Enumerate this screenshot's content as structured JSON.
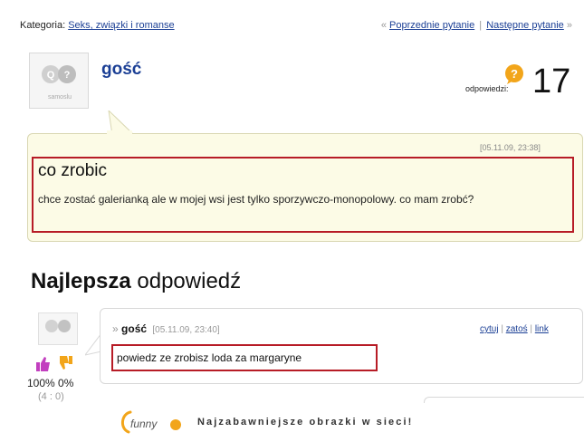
{
  "topbar": {
    "category_label": "Kategoria:",
    "category_link": "Seks, związki i romanse",
    "prev_arrow": "«",
    "prev_link": "Poprzednie pytanie",
    "separator": "|",
    "next_link": "Następne pytanie",
    "next_arrow": "»"
  },
  "question": {
    "avatar_caption": "samoslu",
    "author": "gość",
    "answers_label": "odpowiedzi:",
    "answers_count": "17",
    "date": "[05.11.09, 23:38]",
    "title": "co zrobic",
    "body": "chce zostać galerianką ale w mojej wsi jest tylko sporzywczo-monopolowy. co mam zrobć?"
  },
  "best_answer": {
    "heading_bold": "Najlepsza",
    "heading_rest": " odpowiedź",
    "bullet": "»",
    "author": "gość",
    "date": "[05.11.09, 23:40]",
    "links": {
      "cite": "cytuj",
      "report": "zatoś",
      "link": "link",
      "sep": "|"
    },
    "text": "powiedz ze zrobisz loda za margaryne",
    "votes": "100%  0%",
    "vote_count": "(4 : 0)"
  },
  "footer": {
    "logo_text": "funny",
    "tagline": "Najzabawniejsze obrazki w sieci!"
  },
  "colors": {
    "link": "#1b3f95",
    "highlight_border": "#b71c26",
    "question_bubble": "#fcfbe6",
    "answers_icon": "#f2a51a"
  }
}
